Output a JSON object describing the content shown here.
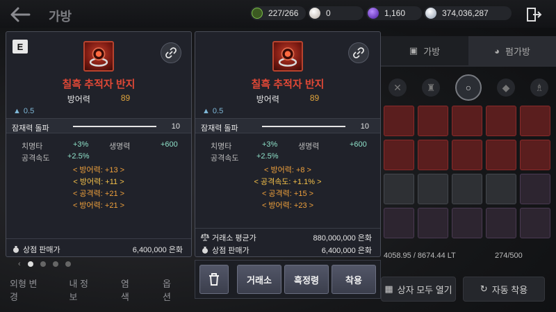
{
  "topbar": {
    "title": "가방",
    "currencies": [
      {
        "icon": "leaf-token-icon",
        "value": "227/266",
        "color": "#7bbf4a"
      },
      {
        "icon": "pearl-icon",
        "value": "0",
        "color": "#d8d2cc"
      },
      {
        "icon": "purple-gem-icon",
        "value": "1,160",
        "color": "#7b3fe0"
      },
      {
        "icon": "silver-coin-icon",
        "value": "374,036,287",
        "color": "#c9d3e0"
      }
    ]
  },
  "inventory": {
    "tabs": [
      {
        "label": "가방",
        "icon": "bag-icon"
      },
      {
        "label": "펌가방",
        "icon": "pet-bag-icon"
      }
    ],
    "weight": "4058.95 / 8674.44 LT",
    "count": "274/500",
    "open_all_label": "상자 모두 열기",
    "auto_equip_label": "자동 착용"
  },
  "bottom_menu": [
    "외형 변경",
    "내 정보",
    "염색",
    "옵션"
  ],
  "equipped_card": {
    "badge": "E",
    "name": "칠흑 추적자 반지",
    "main_stat_label": "방어력",
    "main_stat_value": "89",
    "weight": "0.5",
    "awaken_label": "잠재력 돌파",
    "awaken_value": "10",
    "awaken_fill": 1.0,
    "sub_stats": [
      {
        "label": "치명타",
        "value": "+3%"
      },
      {
        "label": "생명력",
        "value": "+600"
      },
      {
        "label": "공격속도",
        "value": "+2.5%"
      }
    ],
    "bonuses": [
      "< 방어력: +13 >",
      "< 방어력: +11 >",
      "< 공격력: +21 >",
      "< 방어력: +21 >"
    ],
    "shop_price_label": "상점 판매가",
    "shop_price_value": "6,400,000 은화"
  },
  "compare_card": {
    "name": "칠흑 추적자 반지",
    "main_stat_label": "방어력",
    "main_stat_value": "89",
    "weight": "0.5",
    "awaken_label": "잠재력 돌파",
    "awaken_value": "10",
    "awaken_fill": 1.0,
    "sub_stats": [
      {
        "label": "치명타",
        "value": "+3%"
      },
      {
        "label": "생명력",
        "value": "+600"
      },
      {
        "label": "공격속도",
        "value": "+2.5%"
      }
    ],
    "bonuses": [
      "< 방어력: +8 >",
      "< 공격속도: +1.1% >",
      "< 공격력: +15 >",
      "< 방어력: +23 >"
    ],
    "market_price_label": "거래소 평균가",
    "market_price_value": "880,000,000 은화",
    "shop_price_label": "상점 판매가",
    "shop_price_value": "6,400,000 은화"
  },
  "actions": {
    "delete_icon": "trash-icon",
    "trade_label": "거래소",
    "refine_label": "흑정령",
    "equip_label": "착용"
  }
}
